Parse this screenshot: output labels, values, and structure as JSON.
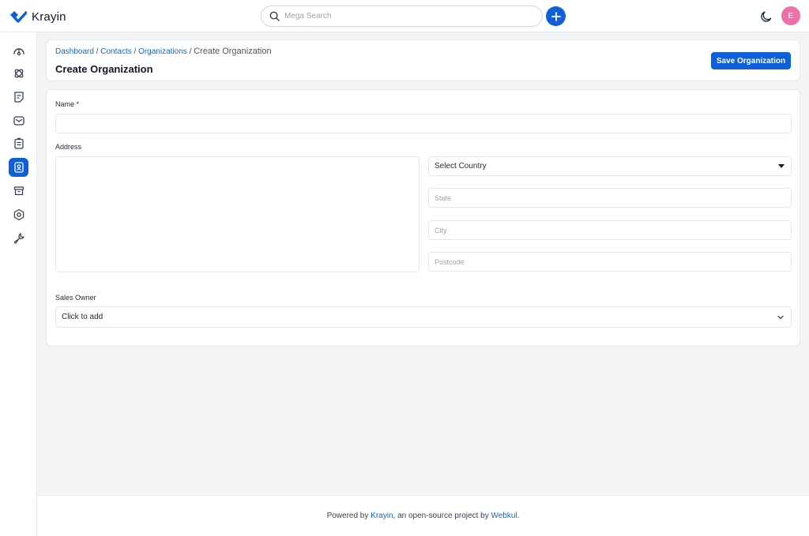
{
  "app": {
    "name": "Krayin"
  },
  "topbar": {
    "search_placeholder": "Mega Search",
    "avatar_initial": "E"
  },
  "sidebar": {
    "items": [
      {
        "icon": "dashboard-icon",
        "active": false
      },
      {
        "icon": "leads-icon",
        "active": false
      },
      {
        "icon": "quotes-icon",
        "active": false
      },
      {
        "icon": "mail-icon",
        "active": false
      },
      {
        "icon": "activities-icon",
        "active": false
      },
      {
        "icon": "contacts-icon",
        "active": true
      },
      {
        "icon": "products-icon",
        "active": false
      },
      {
        "icon": "settings-icon",
        "active": false
      },
      {
        "icon": "configuration-icon",
        "active": false
      }
    ]
  },
  "breadcrumb": {
    "items": [
      "Dashboard",
      "Contacts",
      "Organizations"
    ],
    "separator": "/",
    "current": "Create Organization"
  },
  "page": {
    "title": "Create Organization",
    "save_label": "Save Organization"
  },
  "form": {
    "name_label": "Name *",
    "address_label": "Address",
    "country_value": "Select Country",
    "state_placeholder": "State",
    "city_placeholder": "City",
    "postcode_placeholder": "Postcode",
    "sales_owner_label": "Sales Owner",
    "sales_owner_value": "Click to add"
  },
  "footer": {
    "prefix": "Powered by",
    "link1": "Krayin",
    "middle": ", an open-source project by",
    "link2": "Webkul",
    "suffix": "."
  },
  "colors": {
    "accent": "#0e5fd8",
    "link": "#0e6ac9",
    "avatar": "#ec6fa8"
  }
}
